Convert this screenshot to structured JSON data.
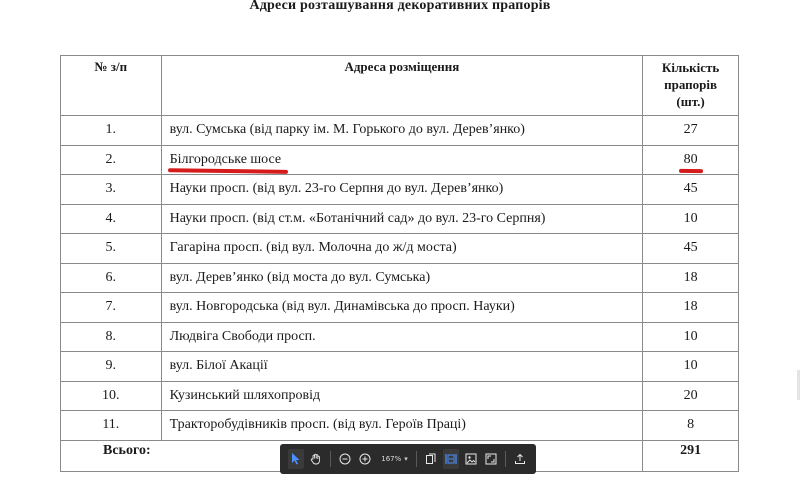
{
  "title": "Адреси розташування декоративних прапорів",
  "table": {
    "headers": {
      "num": "№ з/п",
      "address": "Адреса розміщення",
      "qty_lines": [
        "Кількість",
        "прапорів",
        "(шт.)"
      ]
    },
    "rows": [
      {
        "num": "1.",
        "address": "вул. Сумська (від парку ім. М. Горького до вул. Дерев’янко)",
        "qty": "27"
      },
      {
        "num": "2.",
        "address": "Білгородське шосе",
        "qty": "80"
      },
      {
        "num": "3.",
        "address": "Науки просп. (від вул. 23-го Серпня до вул. Дерев’янко)",
        "qty": "45"
      },
      {
        "num": "4.",
        "address": "Науки просп. (від ст.м. «Ботанічний сад» до вул. 23-го Серпня)",
        "qty": "10"
      },
      {
        "num": "5.",
        "address": "Гагаріна просп. (від вул. Молочна до ж/д моста)",
        "qty": "45"
      },
      {
        "num": "6.",
        "address": "вул. Дерев’янко (від моста до вул. Сумська)",
        "qty": "18"
      },
      {
        "num": "7.",
        "address": "вул. Новгородська (від вул. Динамівська до просп. Науки)",
        "qty": "18"
      },
      {
        "num": "8.",
        "address": "Людвіга Свободи просп.",
        "qty": "10"
      },
      {
        "num": "9.",
        "address": "вул. Білої Акації",
        "qty": "10"
      },
      {
        "num": "10.",
        "address": "Кузинський шляхопровід",
        "qty": "20"
      },
      {
        "num": "11.",
        "address": "Тракторобудівників просп. (від вул. Героїв Праці)",
        "qty": "8"
      }
    ],
    "total": {
      "label": "Всього:",
      "qty": "291"
    },
    "highlight_color": "#d61b1b"
  },
  "toolbar": {
    "zoom": "167%",
    "icons": [
      "pointer-icon",
      "hand-icon",
      "zoom-out-icon",
      "zoom-in-icon",
      "page-view-icon",
      "fit-width-icon",
      "export-image-icon",
      "fullscreen-icon",
      "share-icon"
    ]
  }
}
